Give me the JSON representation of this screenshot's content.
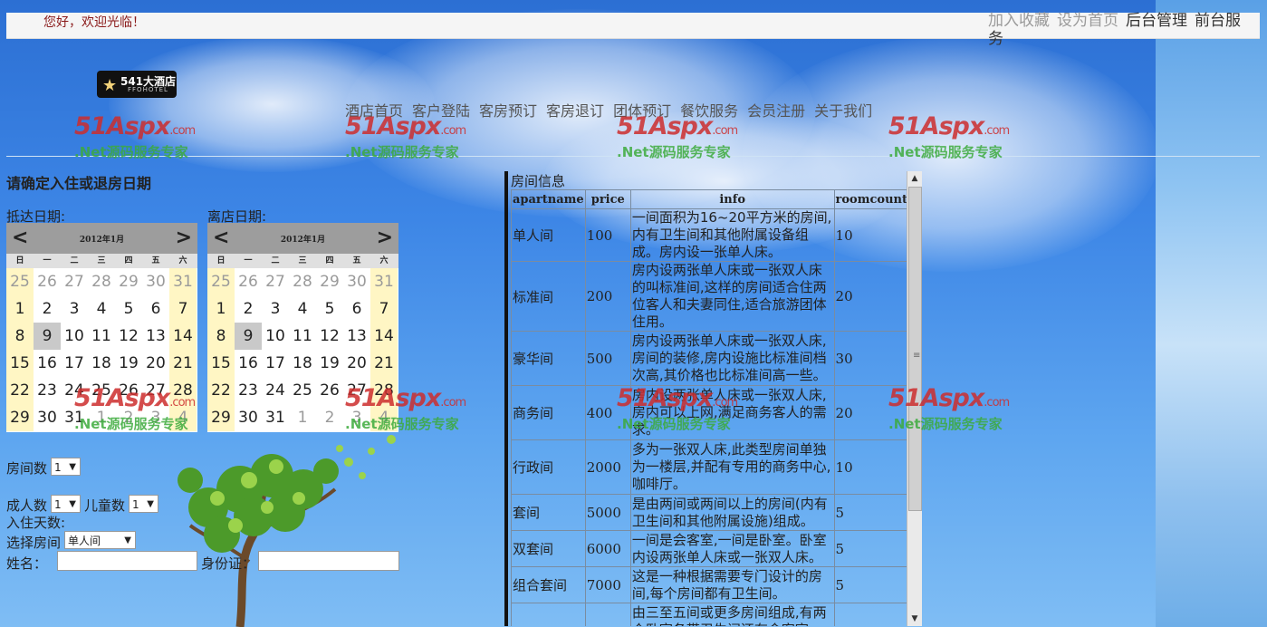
{
  "header": {
    "welcome": "您好，欢迎光临！",
    "links": [
      "加入收藏",
      "设为首页",
      "后台管理",
      "前台服务"
    ]
  },
  "logo": {
    "name": "541大酒店",
    "sub": "FFOHOTEL"
  },
  "nav": [
    "酒店首页",
    "客户登陆",
    "客房预订",
    "客房退订",
    "团体预订",
    "餐饮服务",
    "会员注册",
    "关于我们"
  ],
  "watermark": {
    "brand": "51Aspx",
    "domain": ".com",
    "slogan": ".Net源码服务专家"
  },
  "booking": {
    "title": "请确定入住或退房日期",
    "arrive_label": "抵达日期:",
    "depart_label": "离店日期:",
    "rooms_label": "房间数",
    "rooms_value": "1",
    "adults_label": "成人数",
    "adults_value": "1",
    "children_label": "儿童数",
    "children_value": "1",
    "nights_label": "入住天数:",
    "room_select_label": "选择房间",
    "room_select_value": "单人间",
    "name_label": "姓名：",
    "id_label": "身份证："
  },
  "calendar": {
    "month": "2012年1月",
    "prev": "<",
    "next": ">",
    "weekdays": [
      "日",
      "一",
      "二",
      "三",
      "四",
      "五",
      "六"
    ],
    "weeks": [
      [
        "25",
        "26",
        "27",
        "28",
        "29",
        "30",
        "31"
      ],
      [
        "1",
        "2",
        "3",
        "4",
        "5",
        "6",
        "7"
      ],
      [
        "8",
        "9",
        "10",
        "11",
        "12",
        "13",
        "14"
      ],
      [
        "15",
        "16",
        "17",
        "18",
        "19",
        "20",
        "21"
      ],
      [
        "22",
        "23",
        "24",
        "25",
        "26",
        "27",
        "28"
      ],
      [
        "29",
        "30",
        "31",
        "1",
        "2",
        "3",
        "4"
      ]
    ],
    "selected": "9"
  },
  "rooms_panel": {
    "caption": "房间信息",
    "columns": [
      "apartname",
      "price",
      "info",
      "roomcount"
    ],
    "rows": [
      {
        "apartname": "单人间",
        "price": "100",
        "info": "一间面积为16~20平方米的房间,内有卫生间和其他附属设备组成。房内设一张单人床。",
        "roomcount": "10"
      },
      {
        "apartname": "标准间",
        "price": "200",
        "info": "房内设两张单人床或一张双人床的叫标准间,这样的房间适合住两位客人和夫妻同住,适合旅游团体住用。",
        "roomcount": "20"
      },
      {
        "apartname": "豪华间",
        "price": "500",
        "info": "房内设两张单人床或一张双人床,房间的装修,房内设施比标准间档次高,其价格也比标准间高一些。",
        "roomcount": "30"
      },
      {
        "apartname": "商务间",
        "price": "400",
        "info": "房内设两张单人床或一张双人床,房内可以上网,满足商务客人的需求。",
        "roomcount": "20"
      },
      {
        "apartname": "行政间",
        "price": "2000",
        "info": "多为一张双人床,此类型房间单独为一楼层,并配有专用的商务中心,咖啡厅。",
        "roomcount": "10"
      },
      {
        "apartname": "套间",
        "price": "5000",
        "info": "是由两间或两间以上的房间(内有卫生间和其他附属设施)组成。",
        "roomcount": "5"
      },
      {
        "apartname": "双套间",
        "price": "6000",
        "info": "一间是会客室,一间是卧室。卧室内设两张单人床或一张双人床。",
        "roomcount": "5"
      },
      {
        "apartname": "组合套间",
        "price": "7000",
        "info": "这是一种根据需要专门设计的房间,每个房间都有卫生间。",
        "roomcount": "5"
      },
      {
        "apartname": "",
        "price": "",
        "info": "由三至五间或更多房间组成,有两个卧室各带卫生间还有会客室",
        "roomcount": ""
      }
    ]
  }
}
